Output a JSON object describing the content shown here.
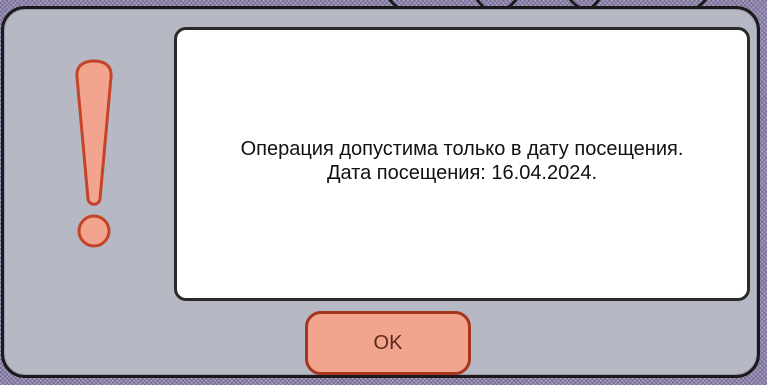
{
  "dialog": {
    "icon": "exclamation-icon",
    "message_line_1": "Операция допустима только в дату посещения.",
    "message_line_2": "Дата посещения: 16.04.2024.",
    "ok_label": "OK"
  },
  "colors": {
    "dialog_background": "#b6b8c3",
    "message_background": "#ffffff",
    "icon_fill": "#f2a48e",
    "icon_stroke": "#c4442a",
    "button_fill": "#f2a48e",
    "button_border": "#a8351e",
    "backdrop": "#8d83aa"
  }
}
